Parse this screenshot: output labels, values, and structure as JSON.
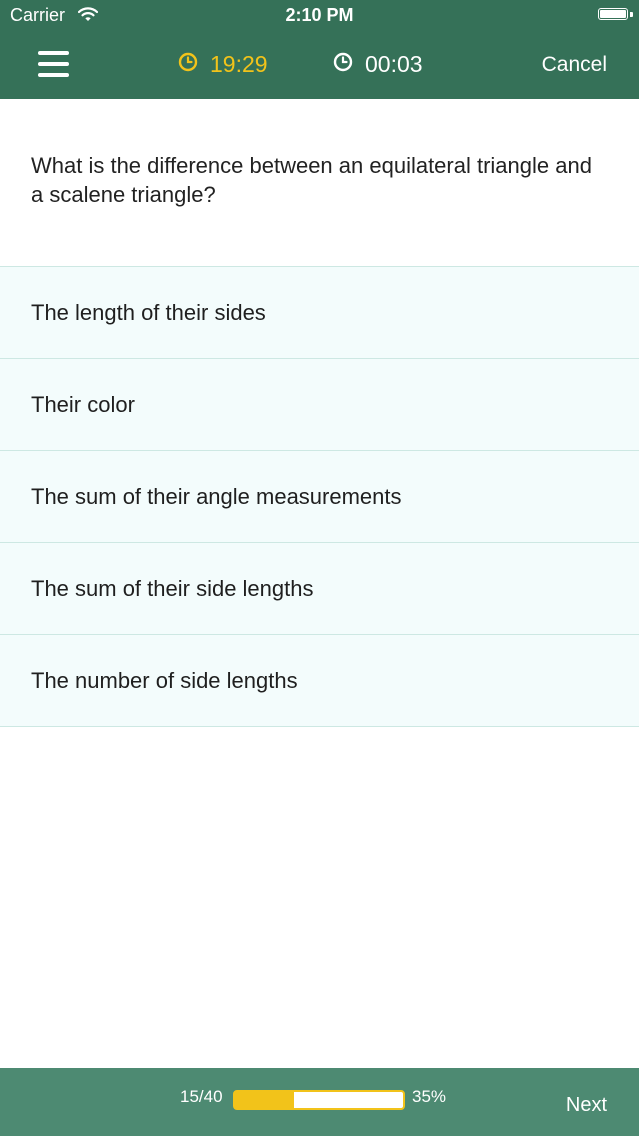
{
  "status_bar": {
    "carrier": "Carrier",
    "time": "2:10 PM"
  },
  "header": {
    "menu_icon": "hamburger-menu-icon",
    "timer_remaining": "19:29",
    "timer_remaining_icon": "clock-icon",
    "timer_remaining_color": "#f2c31a",
    "timer_elapsed": "00:03",
    "timer_elapsed_icon": "clock-icon",
    "cancel_label": "Cancel"
  },
  "question": {
    "text": "What is the difference between an equilateral triangle and a scalene triangle?"
  },
  "answers": [
    {
      "label": "The length of their sides"
    },
    {
      "label": "Their color"
    },
    {
      "label": "The sum of their angle measurements"
    },
    {
      "label": "The sum of their side lengths"
    },
    {
      "label": "The number of side lengths"
    }
  ],
  "footer": {
    "progress_count": "15/40",
    "progress_percent_label": "35%",
    "progress_fraction": 0.35,
    "next_label": "Next"
  },
  "colors": {
    "header_bg": "#357158",
    "footer_bg": "#4d8a72",
    "accent_yellow": "#f2c31a",
    "answer_bg": "#f3fcfc"
  }
}
